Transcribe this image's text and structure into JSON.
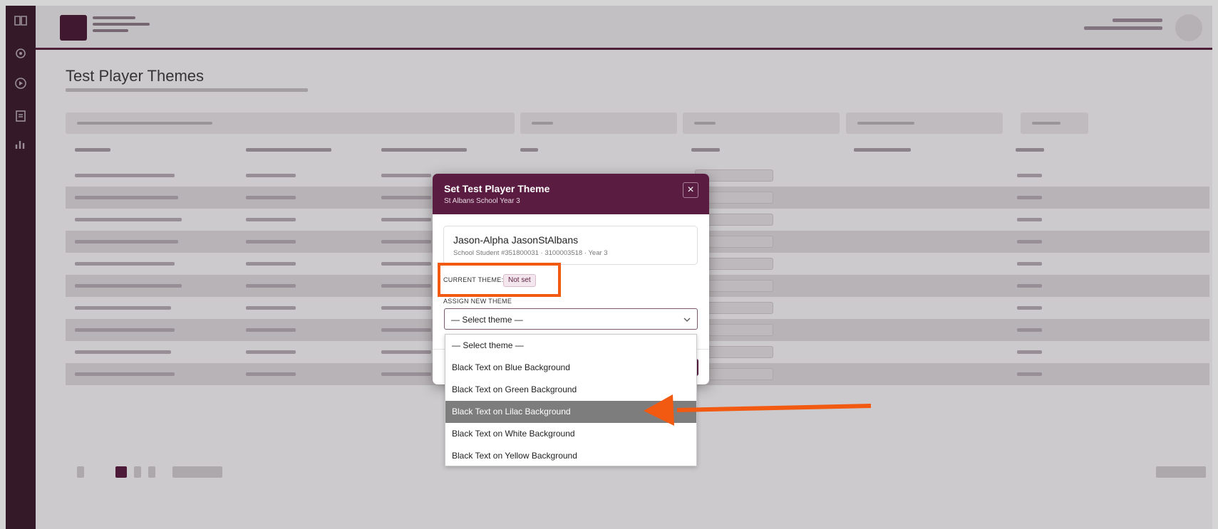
{
  "page": {
    "title": "Test Player Themes"
  },
  "modal": {
    "title": "Set Test Player Theme",
    "subtitle": "St Albans School Year 3",
    "close_label": "×",
    "student": {
      "name": "Jason-Alpha JasonStAlbans",
      "meta": "School Student #351800031 · 3100003518 · Year 3"
    },
    "current_theme_label": "CURRENT THEME:",
    "current_theme_value": "Not set",
    "assign_label": "ASSIGN NEW THEME",
    "select_value": "— Select theme —",
    "options": [
      "— Select theme —",
      "Black Text on Blue Background",
      "Black Text on Green Background",
      "Black Text on Lilac Background",
      "Black Text on White Background",
      "Black Text on Yellow Background"
    ],
    "highlighted_option_index": 3
  },
  "colors": {
    "brand": "#5a1d41",
    "annotation": "#f25a12",
    "highlight": "#7d7d7d"
  }
}
